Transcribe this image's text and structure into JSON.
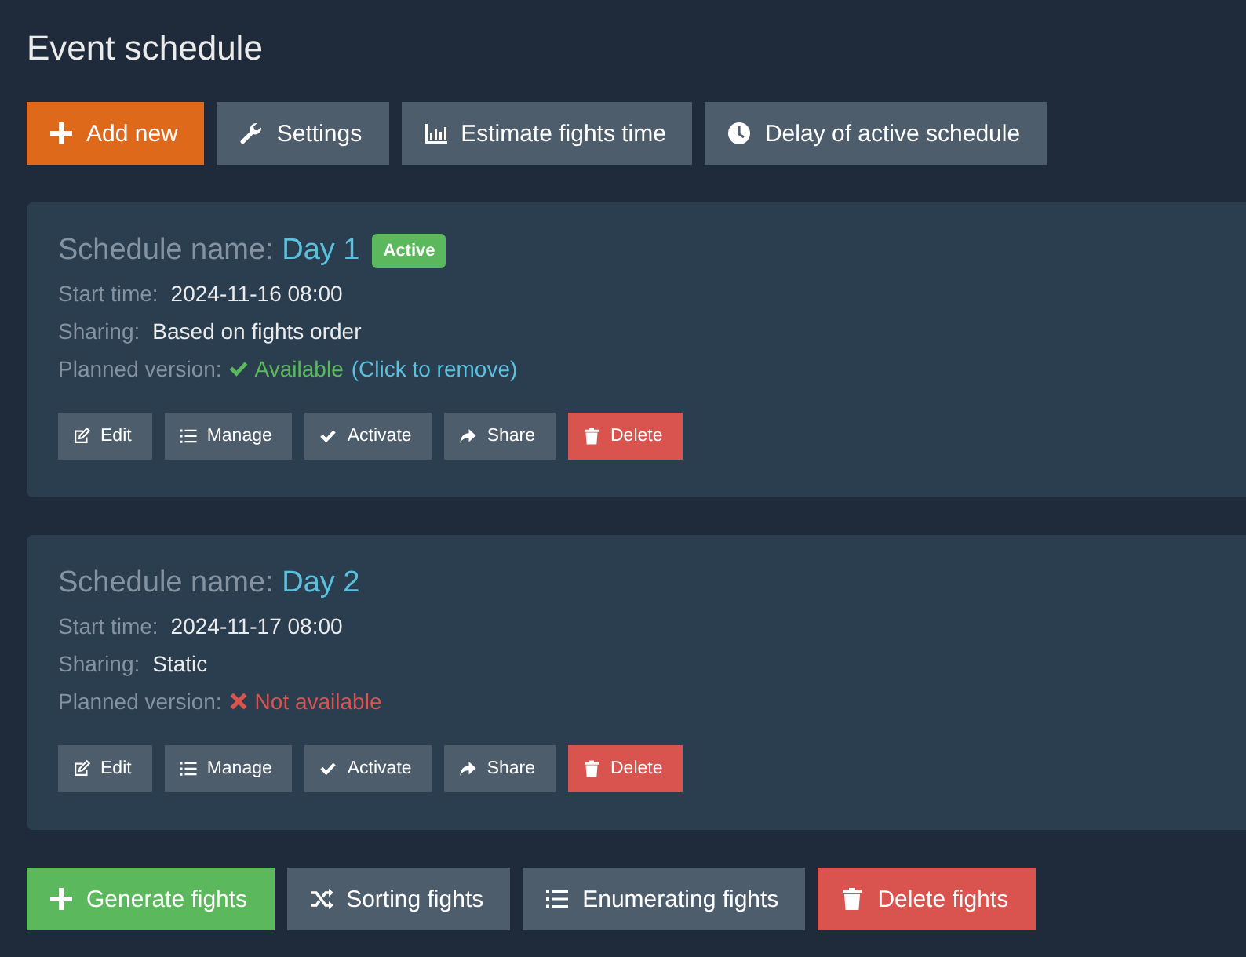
{
  "title": "Event schedule",
  "toolbar": [
    {
      "label": "Add new",
      "kind": "primary"
    },
    {
      "label": "Settings",
      "kind": "default"
    },
    {
      "label": "Estimate fights time",
      "kind": "default"
    },
    {
      "label": "Delay of active schedule",
      "kind": "default"
    }
  ],
  "schedules": [
    {
      "name_label": "Schedule name:",
      "name": "Day 1",
      "active": true,
      "badge": "Active",
      "start_label": "Start time:",
      "start_time": "2024-11-16 08:00",
      "sharing_label": "Sharing:",
      "sharing": "Based on fights order",
      "planned_label": "Planned version:",
      "planned_available": true,
      "planned_text": "Available",
      "planned_link": "(Click to remove)",
      "buttons": [
        {
          "label": "Edit",
          "kind": "default"
        },
        {
          "label": "Manage",
          "kind": "default"
        },
        {
          "label": "Activate",
          "kind": "default"
        },
        {
          "label": "Share",
          "kind": "default"
        },
        {
          "label": "Delete",
          "kind": "danger"
        }
      ]
    },
    {
      "name_label": "Schedule name:",
      "name": "Day 2",
      "active": false,
      "start_label": "Start time:",
      "start_time": "2024-11-17 08:00",
      "sharing_label": "Sharing:",
      "sharing": "Static",
      "planned_label": "Planned version:",
      "planned_available": false,
      "planned_text": "Not available",
      "buttons": [
        {
          "label": "Edit",
          "kind": "default"
        },
        {
          "label": "Manage",
          "kind": "default"
        },
        {
          "label": "Activate",
          "kind": "default"
        },
        {
          "label": "Share",
          "kind": "default"
        },
        {
          "label": "Delete",
          "kind": "danger"
        }
      ]
    }
  ],
  "bottom_bar": [
    {
      "label": "Generate fights",
      "kind": "success"
    },
    {
      "label": "Sorting fights",
      "kind": "default"
    },
    {
      "label": "Enumerating fights",
      "kind": "default"
    },
    {
      "label": "Delete fights",
      "kind": "danger"
    }
  ]
}
